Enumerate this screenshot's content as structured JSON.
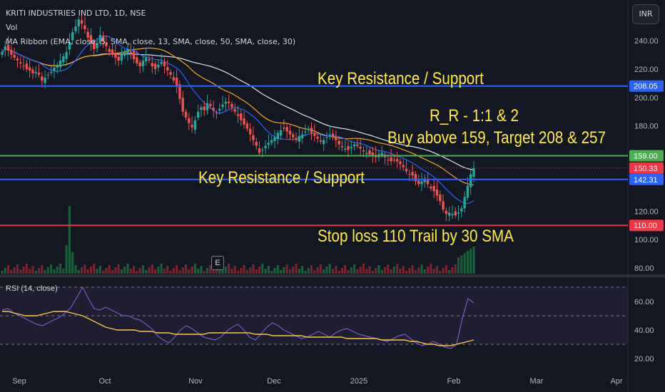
{
  "header": {
    "symbol_line": "KRITI INDUSTRIES IND LTD, 1D, NSE",
    "volume_label": "Vol",
    "ribbon_label": "MA Ribbon (EMA, close, 5, SMA, close, 13, SMA, close, 50, SMA, close, 30)",
    "currency_button": "INR"
  },
  "annotations": {
    "resistance_top": "Key Resistance / Support",
    "resistance_mid": "Key Resistance / Support",
    "risk_reward": "R_R - 1:1 & 2",
    "buy_plan": "Buy above 159, Target 208 & 257",
    "stop_loss": "Stop loss 110 Trail by 30 SMA"
  },
  "earnings_marker": "E",
  "chart_data": [
    {
      "type": "candlestick",
      "panel": "price",
      "ylim": [
        75,
        262
      ],
      "y_ticks": [
        "240.00",
        "220.00",
        "200.00",
        "180.00",
        "120.00",
        "100.00",
        "80.00"
      ],
      "x_ticks": [
        "Sep",
        "Oct",
        "Nov",
        "Dec",
        "2025",
        "Feb",
        "Mar",
        "Apr"
      ],
      "levels": [
        {
          "label": "208.05",
          "value": 208.05,
          "color": "#2962ff"
        },
        {
          "label": "159.00",
          "value": 159.0,
          "color": "#4caf50"
        },
        {
          "label": "150.33",
          "value": 150.33,
          "color": "#f23645"
        },
        {
          "label": "142.31",
          "value": 142.31,
          "color": "#2962ff"
        },
        {
          "label": "110.00",
          "value": 110.0,
          "color": "#f23645"
        }
      ],
      "close": [
        232,
        236,
        233,
        230,
        228,
        226,
        224,
        222,
        220,
        219,
        217,
        218,
        216,
        212,
        214,
        216,
        218,
        221,
        222,
        226,
        229,
        232,
        239,
        246,
        250,
        255,
        252,
        248,
        242,
        238,
        234,
        238,
        244,
        240,
        236,
        232,
        230,
        228,
        226,
        230,
        232,
        234,
        231,
        227,
        224,
        222,
        226,
        228,
        226,
        222,
        220,
        223,
        225,
        222,
        219,
        216,
        212,
        208,
        199,
        190,
        186,
        182,
        179,
        184,
        190,
        193,
        191,
        196,
        194,
        191,
        189,
        192,
        195,
        197,
        196,
        193,
        190,
        187,
        184,
        181,
        178,
        174,
        170,
        166,
        161,
        163,
        166,
        168,
        170,
        172,
        175,
        177,
        178,
        176,
        174,
        172,
        170,
        173,
        174,
        176,
        178,
        175,
        173,
        171,
        169,
        170,
        172,
        174,
        172,
        170,
        167,
        165,
        164,
        163,
        165,
        167,
        166,
        164,
        162,
        161,
        160,
        159,
        158,
        160,
        161,
        158,
        156,
        155,
        156,
        155,
        153,
        151,
        148,
        146,
        145,
        141,
        139,
        141,
        143,
        139,
        136,
        134,
        131,
        127,
        121,
        118,
        119,
        118,
        117,
        119,
        122,
        130,
        138,
        146,
        150.33
      ],
      "volume": [
        "relative bars",
        "spikes near Sep and early Feb"
      ]
    },
    {
      "type": "line",
      "panel": "oscillator",
      "title": "RSI (14, close)",
      "ylim": [
        15,
        72
      ],
      "y_ticks": [
        "60.00",
        "40.00",
        "20.00"
      ],
      "bands": [
        30,
        50,
        70
      ],
      "series": [
        {
          "name": "RSI",
          "color": "#7e57c2",
          "values": [
            54,
            55,
            52,
            50,
            48,
            46,
            44,
            43,
            45,
            47,
            49,
            52,
            56,
            63,
            70,
            62,
            55,
            54,
            56,
            54,
            52,
            50,
            50,
            48,
            47,
            44,
            41,
            36,
            33,
            31,
            35,
            40,
            43,
            41,
            38,
            35,
            34,
            33,
            35,
            39,
            42,
            44,
            40,
            35,
            33,
            37,
            42,
            45,
            43,
            40,
            38,
            36,
            34,
            35,
            37,
            39,
            37,
            35,
            38,
            40,
            41,
            39,
            37,
            36,
            35,
            34,
            33,
            32,
            34,
            36,
            37,
            34,
            31,
            29,
            30,
            32,
            30,
            28,
            27,
            30,
            48,
            62,
            59
          ]
        },
        {
          "name": "RSI-based MA",
          "color": "#f7c948",
          "values": [
            53,
            53,
            52,
            51,
            50,
            50,
            50,
            51,
            52,
            53,
            53,
            53,
            52,
            51,
            50,
            48,
            46,
            44,
            42,
            41,
            40,
            40,
            40,
            40,
            39,
            39,
            39,
            38,
            38,
            38,
            37,
            37,
            37,
            37,
            37,
            37,
            38,
            38,
            38,
            38,
            38,
            38,
            38,
            38,
            37,
            37,
            37,
            36,
            36,
            36,
            36,
            36,
            36,
            35,
            35,
            35,
            35,
            35,
            35,
            35,
            34,
            34,
            34,
            34,
            34,
            34,
            33,
            33,
            33,
            33,
            33,
            32,
            32,
            31,
            30,
            30,
            29,
            29,
            29,
            30,
            31,
            32,
            33
          ]
        }
      ]
    }
  ]
}
